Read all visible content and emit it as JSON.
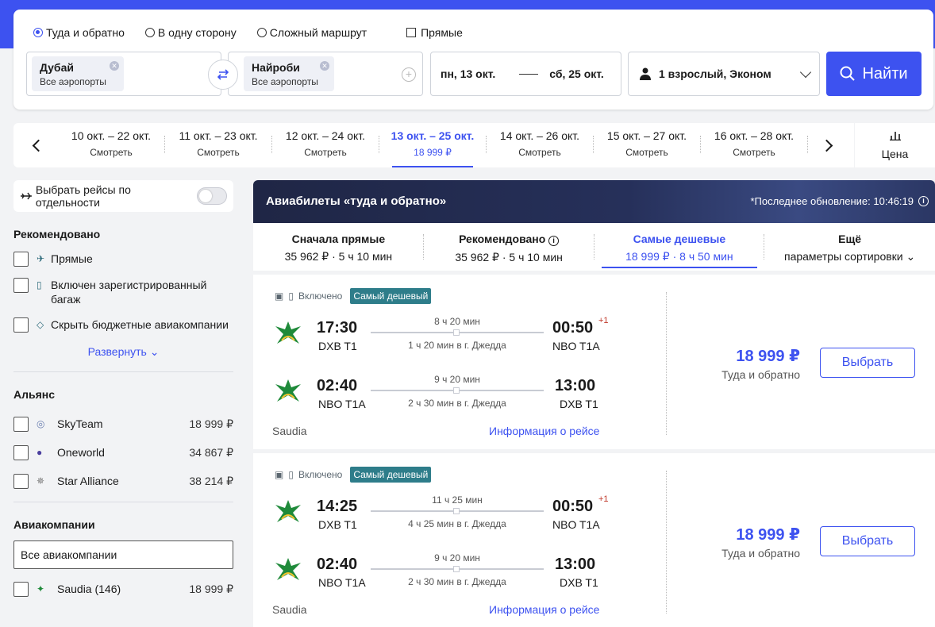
{
  "colors": {
    "accent": "#3d52f0",
    "badge": "#2e7d8a",
    "header_bg": "#1f2645"
  },
  "search": {
    "trip_types": [
      {
        "label": "Туда и обратно",
        "selected": true
      },
      {
        "label": "В одну сторону",
        "selected": false
      },
      {
        "label": "Сложный маршрут",
        "selected": false
      }
    ],
    "direct_label": "Прямые",
    "from": {
      "city": "Дубай",
      "sub": "Все аэропорты"
    },
    "to": {
      "city": "Найроби",
      "sub": "Все аэропорты"
    },
    "date_from": "пн, 13 окт.",
    "date_to": "сб, 25 окт.",
    "passengers": "1 взрослый, Эконом",
    "find_label": "Найти"
  },
  "date_strip": {
    "items": [
      {
        "dates": "10 окт. – 22 окт.",
        "sub": "Смотреть",
        "active": false
      },
      {
        "dates": "11 окт. – 23 окт.",
        "sub": "Смотреть",
        "active": false
      },
      {
        "dates": "12 окт. – 24 окт.",
        "sub": "Смотреть",
        "active": false
      },
      {
        "dates": "13 окт. – 25 окт.",
        "sub": "18 999 ₽",
        "active": true
      },
      {
        "dates": "14 окт. – 26 окт.",
        "sub": "Смотреть",
        "active": false
      },
      {
        "dates": "15 окт. – 27 окт.",
        "sub": "Смотреть",
        "active": false
      },
      {
        "dates": "16 окт. – 28 окт.",
        "sub": "Смотреть",
        "active": false
      }
    ],
    "price_tab": "Цена"
  },
  "sidebar": {
    "toggle_label": "Выбрать рейсы по отдельности",
    "recommended_title": "Рекомендовано",
    "recommended": [
      {
        "label": "Прямые",
        "icon": "plane-icon"
      },
      {
        "label": "Включен зарегистрированный багаж",
        "icon": "luggage-icon"
      },
      {
        "label": "Скрыть бюджетные авиакомпании",
        "icon": "tag-icon"
      }
    ],
    "expand_label": "Развернуть",
    "alliance_title": "Альянс",
    "alliances": [
      {
        "name": "SkyTeam",
        "price": "18 999 ₽"
      },
      {
        "name": "Oneworld",
        "price": "34 867 ₽"
      },
      {
        "name": "Star Alliance",
        "price": "38 214 ₽"
      }
    ],
    "airlines_title": "Авиакомпании",
    "airlines_input": "Все авиакомпании",
    "airline_rows": [
      {
        "name": "Saudia (146)",
        "price": "18 999 ₽"
      }
    ]
  },
  "results": {
    "title": "Авиабилеты «туда и обратно»",
    "updated": "*Последнее обновление: 10:46:19",
    "sort": [
      {
        "title": "Сначала прямые",
        "value": "35 962 ₽ · 5 ч 10 мин",
        "active": false
      },
      {
        "title": "Рекомендовано",
        "value": "35 962 ₽ · 5 ч 10 мин",
        "active": false
      },
      {
        "title": "Самые дешевые",
        "value": "18 999 ₽ · 8 ч 50 мин",
        "active": true
      },
      {
        "title": "Ещё",
        "value": "параметры сортировки",
        "active": false
      }
    ],
    "cards": [
      {
        "baggage": "Включено",
        "badge": "Самый дешевый",
        "out": {
          "dep_time": "17:30",
          "dep_code": "DXB T1",
          "arr_time": "00:50",
          "arr_code": "NBO T1A",
          "plus": "+1",
          "duration": "8 ч 20 мин",
          "stop": "1 ч 20 мин в г. Джедда"
        },
        "back": {
          "dep_time": "02:40",
          "dep_code": "NBO T1A",
          "arr_time": "13:00",
          "arr_code": "DXB T1",
          "plus": "",
          "duration": "9 ч 20 мин",
          "stop": "2 ч 30 мин в г. Джедда"
        },
        "carrier": "Saudia",
        "info_link": "Информация о рейсе",
        "price": "18 999 ₽",
        "price_sub": "Туда и обратно",
        "select_label": "Выбрать"
      },
      {
        "baggage": "Включено",
        "badge": "Самый дешевый",
        "out": {
          "dep_time": "14:25",
          "dep_code": "DXB T1",
          "arr_time": "00:50",
          "arr_code": "NBO T1A",
          "plus": "+1",
          "duration": "11 ч 25 мин",
          "stop": "4 ч 25 мин в г. Джедда"
        },
        "back": {
          "dep_time": "02:40",
          "dep_code": "NBO T1A",
          "arr_time": "13:00",
          "arr_code": "DXB T1",
          "plus": "",
          "duration": "9 ч 20 мин",
          "stop": "2 ч 30 мин в г. Джедда"
        },
        "carrier": "Saudia",
        "info_link": "Информация о рейсе",
        "price": "18 999 ₽",
        "price_sub": "Туда и обратно",
        "select_label": "Выбрать"
      }
    ]
  }
}
